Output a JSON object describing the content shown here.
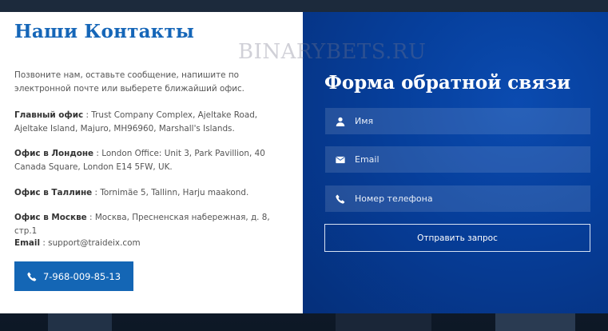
{
  "watermark": "BINARYBETS.RU",
  "contacts": {
    "title": "Наши Контакты",
    "intro": "Позвоните нам, оставьте сообщение, напишите по электронной почте или выберете ближайший офис.",
    "main_office_label": "Главный офис",
    "main_office_value": " : Trust Company Complex, Ajeltake Road, Ajeltake Island, Majuro, MH96960, Marshall's Islands.",
    "london_label": "Офис в Лондоне",
    "london_value": " : London Office: Unit 3, Park Pavillion, 40 Canada Square, London E14 5FW, UK.",
    "tallinn_label": "Офис в Таллине",
    "tallinn_value": " : Tornimäe 5, Tallinn, Harju maakond.",
    "moscow_label": "Офис в Москве",
    "moscow_value": " : Москва, Пресненская набережная, д. 8, стр.1",
    "email_label": "Email",
    "email_value": " : support@traideix.com",
    "phone": "7-968-009-85-13"
  },
  "form": {
    "title": "Форма обратной связи",
    "name_placeholder": "Имя",
    "email_placeholder": "Email",
    "phone_placeholder": "Номер телефона",
    "submit_label": "Отправить запрос"
  },
  "icons": {
    "phone": "phone-icon",
    "user": "user-icon",
    "envelope": "envelope-icon"
  },
  "colors": {
    "accent": "#1566b8",
    "button": "#1466b5",
    "form_bg": "#063f9c"
  }
}
